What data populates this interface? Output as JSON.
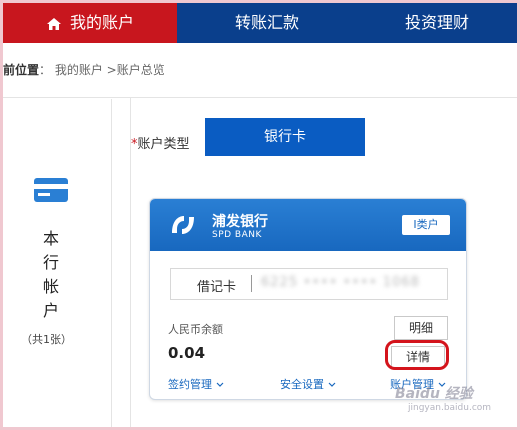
{
  "nav": {
    "home": "我的账户",
    "transfer": "转账汇款",
    "invest": "投资理财"
  },
  "breadcrumb": {
    "lead": "前位置",
    "colon": "：",
    "path": "我的账户 >账户总览"
  },
  "left": {
    "title_chars": [
      "本",
      "行",
      "帐",
      "户"
    ],
    "count": "（共1张）"
  },
  "account_type": {
    "star": "*",
    "label": "账户类型",
    "button": "银行卡"
  },
  "card": {
    "bank_name": "浦发银行",
    "bank_name_en": "SPD BANK",
    "class_badge": "I类户",
    "cardno_label": "借记卡",
    "cardno_masked": "6225 •••• •••• 1068",
    "rmb_label": "人民币余额",
    "rmb_value": "0.04",
    "btn_statement": "明细",
    "btn_detail": "详情",
    "link_sign": "签约管理",
    "link_security": "安全设置",
    "link_account": "账户管理"
  },
  "watermark": {
    "main": "Baidu 经验",
    "sub": "jingyan.baidu.com"
  },
  "colors": {
    "nav_bg": "#0a3f8c",
    "nav_active": "#c8161e",
    "accent": "#0a5cc2",
    "highlight": "#d4141c"
  }
}
